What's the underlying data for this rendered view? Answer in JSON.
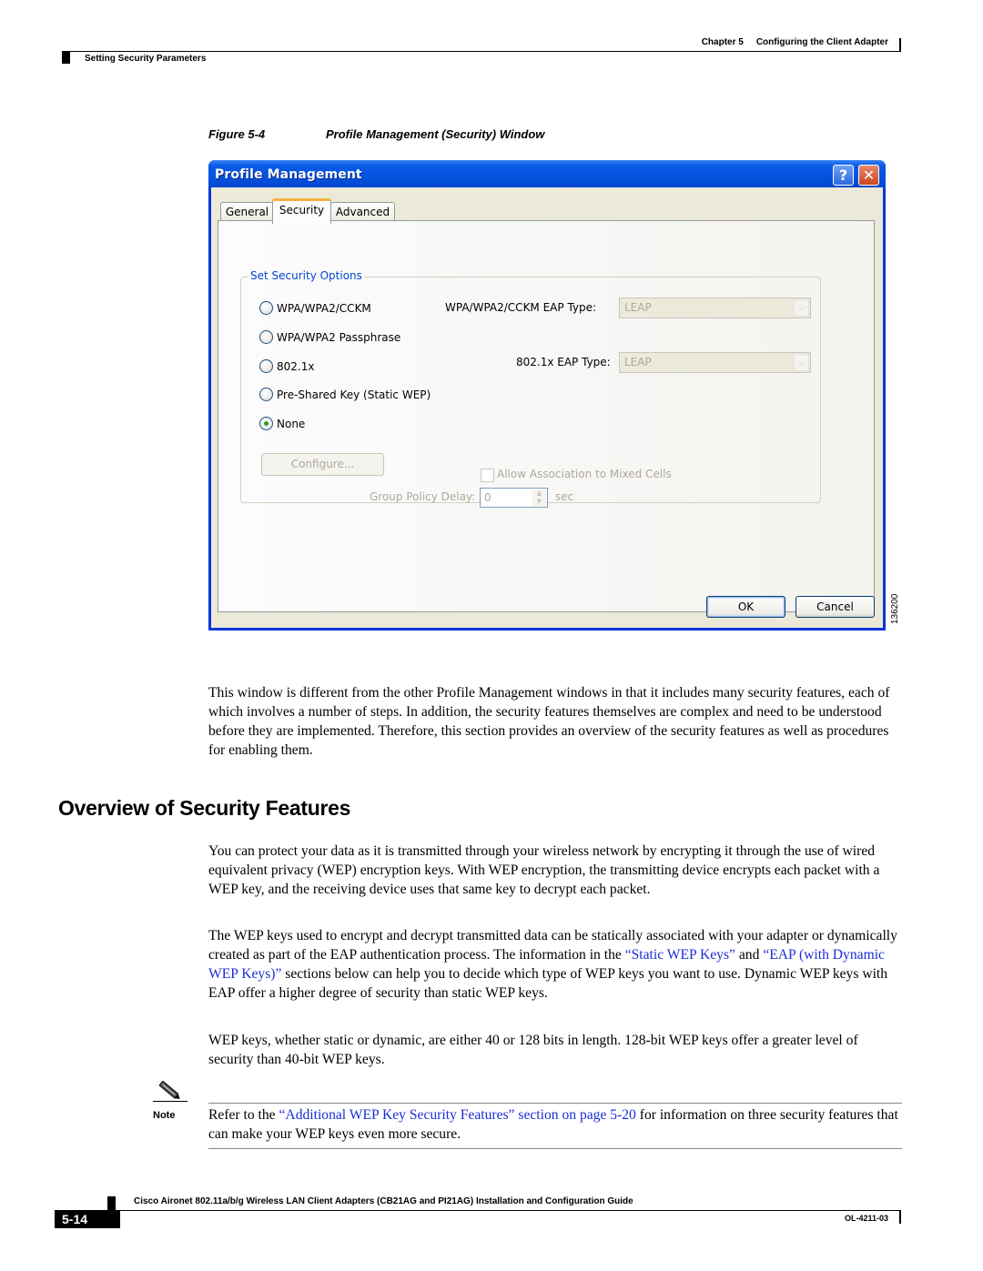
{
  "header": {
    "chapter": "Chapter 5",
    "chapter_title": "Configuring the Client Adapter",
    "section": "Setting Security Parameters"
  },
  "figure": {
    "number": "Figure 5-4",
    "title": "Profile Management (Security) Window",
    "id": "136200"
  },
  "window": {
    "title": "Profile Management",
    "help_glyph": "?",
    "close_glyph": "✕",
    "tabs": [
      {
        "label": "General",
        "active": false
      },
      {
        "label": "Security",
        "active": true
      },
      {
        "label": "Advanced",
        "active": false
      }
    ],
    "group_title": "Set Security Options",
    "radios": [
      {
        "label": "WPA/WPA2/CCKM",
        "checked": false
      },
      {
        "label": "WPA/WPA2 Passphrase",
        "checked": false
      },
      {
        "label": "802.1x",
        "checked": false
      },
      {
        "label": "Pre-Shared Key (Static WEP)",
        "checked": false
      },
      {
        "label": "None",
        "checked": true
      }
    ],
    "wpa_eap_label": "WPA/WPA2/CCKM EAP Type:",
    "wpa_eap_value": "LEAP",
    "dot1x_eap_label": "802.1x EAP Type:",
    "dot1x_eap_value": "LEAP",
    "configure_label": "Configure...",
    "mixed_cells_label": "Allow Association to Mixed Cells",
    "mixed_cells_checked": false,
    "group_policy_label": "Group Policy Delay:",
    "group_policy_value": "0",
    "group_policy_unit": "sec",
    "ok_label": "OK",
    "cancel_label": "Cancel"
  },
  "intro_paragraph": "This window is different from the other Profile Management windows in that it includes many security features, each of which involves a number of steps. In addition, the security features themselves are complex and need to be understood before they are implemented. Therefore, this section provides an overview of the security features as well as procedures for enabling them.",
  "section_heading": "Overview of Security Features",
  "paragraphs": {
    "p1": "You can protect your data as it is transmitted through your wireless network by encrypting it through the use of wired equivalent privacy (WEP) encryption keys. With WEP encryption, the transmitting device encrypts each packet with a WEP key, and the receiving device uses that same key to decrypt each packet.",
    "p2_a": "The WEP keys used to encrypt and decrypt transmitted data can be statically associated with your adapter or dynamically created as part of the EAP authentication process. The information in the ",
    "p2_link1": "“Static WEP Keys”",
    "p2_b": " and ",
    "p2_link2": "“EAP (with Dynamic WEP Keys)”",
    "p2_c": " sections below can help you to decide which type of WEP keys you want to use. Dynamic WEP keys with EAP offer a higher degree of security than static WEP keys.",
    "p3": "WEP keys, whether static or dynamic, are either 40 or 128 bits in length. 128-bit WEP keys offer a greater level of security than 40-bit WEP keys."
  },
  "note": {
    "label": "Note",
    "text_a": "Refer to the ",
    "link": "“Additional WEP Key Security Features” section on page 5-20",
    "text_b": " for information on three security features that can make your WEP keys even more secure."
  },
  "footer": {
    "guide_title": "Cisco Aironet 802.11a/b/g Wireless LAN Client Adapters (CB21AG and PI21AG) Installation and Configuration Guide",
    "page_number": "5-14",
    "doc_number": "OL-4211-03"
  },
  "colors": {
    "link": "#1a2dd6",
    "xp_title_blue": "#0453e0",
    "group_title_blue": "#0046d5",
    "active_tab_accent": "#f6b13c"
  }
}
